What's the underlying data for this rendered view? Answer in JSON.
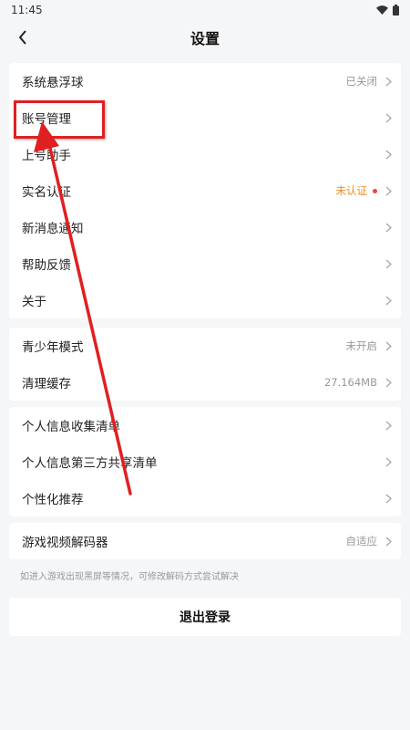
{
  "status_bar": {
    "time": "11:45",
    "icons": [
      "wifi-icon",
      "battery-icon"
    ]
  },
  "header": {
    "back_icon": "chevron-left-icon",
    "title": "设置"
  },
  "groups": [
    {
      "items": [
        {
          "label": "系统悬浮球",
          "value": "已关闭"
        },
        {
          "label": "账号管理",
          "value": ""
        },
        {
          "label": "上号助手",
          "value": ""
        },
        {
          "label": "实名认证",
          "value": "未认证",
          "value_color": "#f08a24",
          "badge": "red-dot"
        },
        {
          "label": "新消息通知",
          "value": ""
        },
        {
          "label": "帮助反馈",
          "value": ""
        },
        {
          "label": "关于",
          "value": ""
        }
      ]
    },
    {
      "items": [
        {
          "label": "青少年模式",
          "value": "未开启"
        },
        {
          "label": "清理缓存",
          "value": "27.164MB"
        }
      ]
    },
    {
      "items": [
        {
          "label": "个人信息收集清单",
          "value": ""
        },
        {
          "label": "个人信息第三方共享清单",
          "value": ""
        },
        {
          "label": "个性化推荐",
          "value": ""
        }
      ]
    },
    {
      "items": [
        {
          "label": "游戏视频解码器",
          "value": "自适应"
        }
      ]
    }
  ],
  "decoder_hint": "如进入游戏出现黑屏等情况，可修改解码方式尝试解决",
  "logout_label": "退出登录",
  "annotation": {
    "color": "#e02020",
    "target": "账号管理"
  },
  "colors": {
    "background": "#f5f6f8",
    "card": "#ffffff",
    "warning_text": "#f08a24",
    "red_dot": "#f44336"
  }
}
